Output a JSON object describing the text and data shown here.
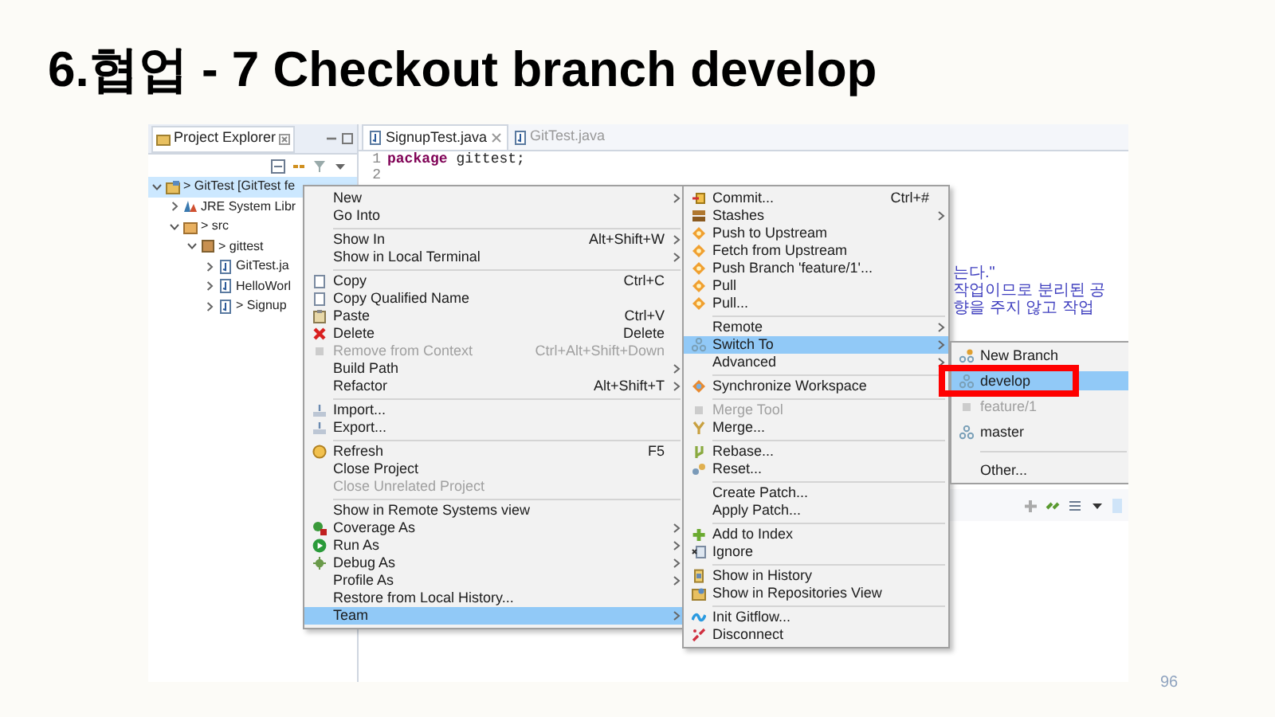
{
  "slide": {
    "title": "6.협업 - 7 Checkout branch develop",
    "page_number": "96"
  },
  "project_explorer": {
    "title": "Project Explorer",
    "tree": [
      {
        "kind": "project",
        "label": "> GitTest [GitTest fe",
        "expanded": true,
        "selected": true,
        "children": [
          {
            "kind": "library",
            "label": "JRE System Libr",
            "expanded": false,
            "selected": false
          },
          {
            "kind": "folder",
            "label": "> src",
            "expanded": true,
            "selected": false,
            "children": [
              {
                "kind": "package",
                "label": "> gittest",
                "expanded": true,
                "selected": false,
                "children": [
                  {
                    "kind": "file",
                    "label": "GitTest.ja",
                    "expanded": false,
                    "selected": false
                  },
                  {
                    "kind": "file",
                    "label": "HelloWorl",
                    "expanded": false,
                    "selected": false
                  },
                  {
                    "kind": "file",
                    "label": "> Signup",
                    "expanded": false,
                    "selected": false
                  }
                ]
              }
            ]
          }
        ]
      }
    ]
  },
  "editor": {
    "tabs": [
      {
        "label": "SignupTest.java",
        "selected": true
      },
      {
        "label": "GitTest.java",
        "selected": false
      }
    ],
    "lines": [
      {
        "number": "1",
        "keyword": "package",
        "text": " gittest;"
      },
      {
        "number": "2"
      }
    ],
    "comment_lines": [
      "는다.\"",
      "작업이므로 분리된 공",
      "향을 주지 않고 작업"
    ]
  },
  "context_menu": {
    "items": [
      {
        "kind": "item",
        "label": "New",
        "submenu": true
      },
      {
        "kind": "item",
        "label": "Go Into"
      },
      {
        "kind": "separator"
      },
      {
        "kind": "item",
        "label": "Show In",
        "shortcut": "Alt+Shift+W",
        "submenu": true
      },
      {
        "kind": "item",
        "label": "Show in Local Terminal",
        "submenu": true
      },
      {
        "kind": "separator"
      },
      {
        "kind": "item",
        "label": "Copy",
        "shortcut": "Ctrl+C"
      },
      {
        "kind": "item",
        "label": "Copy Qualified Name"
      },
      {
        "kind": "item",
        "label": "Paste",
        "shortcut": "Ctrl+V"
      },
      {
        "kind": "item",
        "label": "Delete",
        "shortcut": "Delete"
      },
      {
        "kind": "item",
        "label": "Remove from Context",
        "shortcut": "Ctrl+Alt+Shift+Down",
        "disabled": true
      },
      {
        "kind": "item",
        "label": "Build Path",
        "submenu": true
      },
      {
        "kind": "item",
        "label": "Refactor",
        "shortcut": "Alt+Shift+T",
        "submenu": true
      },
      {
        "kind": "separator"
      },
      {
        "kind": "item",
        "label": "Import..."
      },
      {
        "kind": "item",
        "label": "Export..."
      },
      {
        "kind": "separator"
      },
      {
        "kind": "item",
        "label": "Refresh",
        "shortcut": "F5"
      },
      {
        "kind": "item",
        "label": "Close Project"
      },
      {
        "kind": "item",
        "label": "Close Unrelated Project",
        "disabled": true
      },
      {
        "kind": "separator"
      },
      {
        "kind": "item",
        "label": "Show in Remote Systems view"
      },
      {
        "kind": "item",
        "label": "Coverage As",
        "submenu": true
      },
      {
        "kind": "item",
        "label": "Run As",
        "submenu": true
      },
      {
        "kind": "item",
        "label": "Debug As",
        "submenu": true
      },
      {
        "kind": "item",
        "label": "Profile As",
        "submenu": true
      },
      {
        "kind": "item",
        "label": "Restore from Local History..."
      },
      {
        "kind": "item",
        "label": "Team",
        "submenu": true,
        "selected": true
      }
    ]
  },
  "team_menu": {
    "items": [
      {
        "kind": "item",
        "label": "Commit...",
        "shortcut": "Ctrl+#"
      },
      {
        "kind": "item",
        "label": "Stashes",
        "submenu": true
      },
      {
        "kind": "item",
        "label": "Push to Upstream"
      },
      {
        "kind": "item",
        "label": "Fetch from Upstream"
      },
      {
        "kind": "item",
        "label": "Push Branch 'feature/1'..."
      },
      {
        "kind": "item",
        "label": "Pull"
      },
      {
        "kind": "item",
        "label": "Pull..."
      },
      {
        "kind": "separator"
      },
      {
        "kind": "item",
        "label": "Remote",
        "submenu": true
      },
      {
        "kind": "item",
        "label": "Switch To",
        "submenu": true,
        "selected": true
      },
      {
        "kind": "item",
        "label": "Advanced",
        "submenu": true
      },
      {
        "kind": "separator"
      },
      {
        "kind": "item",
        "label": "Synchronize Workspace"
      },
      {
        "kind": "separator"
      },
      {
        "kind": "item",
        "label": "Merge Tool",
        "disabled": true
      },
      {
        "kind": "item",
        "label": "Merge..."
      },
      {
        "kind": "separator"
      },
      {
        "kind": "item",
        "label": "Rebase..."
      },
      {
        "kind": "item",
        "label": "Reset..."
      },
      {
        "kind": "separator"
      },
      {
        "kind": "item",
        "label": "Create Patch..."
      },
      {
        "kind": "item",
        "label": "Apply Patch..."
      },
      {
        "kind": "separator"
      },
      {
        "kind": "item",
        "label": "Add to Index"
      },
      {
        "kind": "item",
        "label": "Ignore"
      },
      {
        "kind": "separator"
      },
      {
        "kind": "item",
        "label": "Show in History"
      },
      {
        "kind": "item",
        "label": "Show in Repositories View"
      },
      {
        "kind": "separator"
      },
      {
        "kind": "item",
        "label": "Init Gitflow..."
      },
      {
        "kind": "item",
        "label": "Disconnect"
      }
    ]
  },
  "switch_to_menu": {
    "items": [
      {
        "kind": "item",
        "label": "New Branch"
      },
      {
        "kind": "item",
        "label": "develop",
        "selected": true,
        "highlighted": true
      },
      {
        "kind": "item",
        "label": "feature/1",
        "disabled": true
      },
      {
        "kind": "item",
        "label": "master"
      },
      {
        "kind": "separator"
      },
      {
        "kind": "item",
        "label": "Other..."
      }
    ]
  }
}
